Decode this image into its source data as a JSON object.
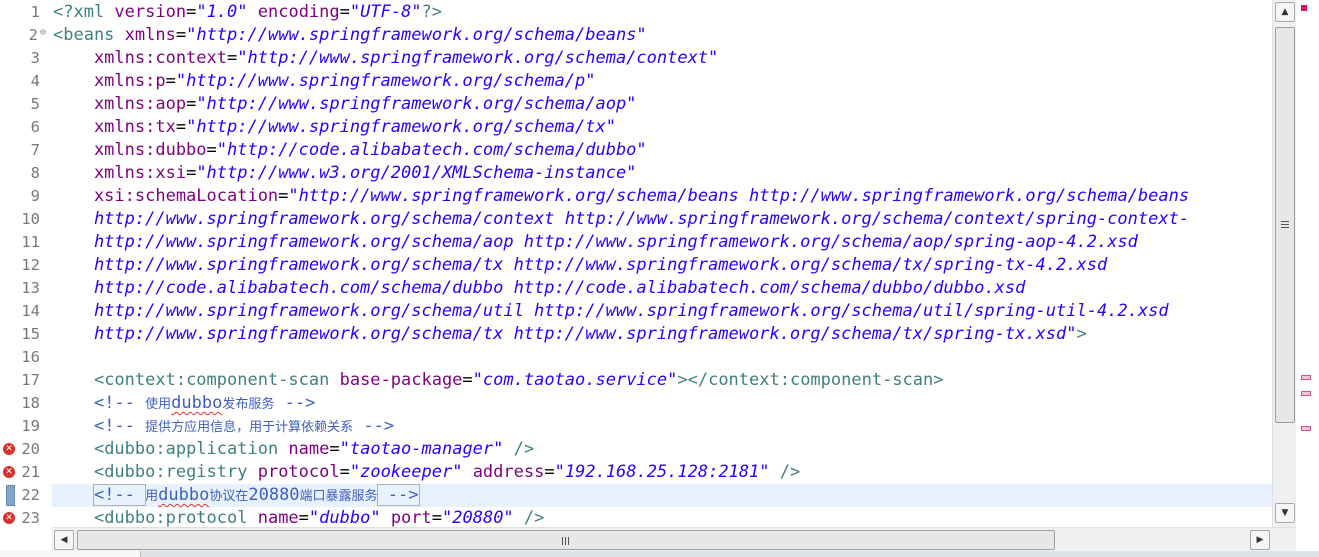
{
  "editor": {
    "line_numbers": [
      "1",
      "2",
      "3",
      "4",
      "5",
      "6",
      "7",
      "8",
      "9",
      "10",
      "11",
      "12",
      "13",
      "14",
      "15",
      "16",
      "17",
      "18",
      "19",
      "20",
      "21",
      "22",
      "23"
    ],
    "fold_icon": "collapse-icon",
    "lines": {
      "l1": {
        "decl_open": "<?xml ",
        "a1": "version",
        "eq1": "=",
        "v1": "\"1.0\"",
        "a2": " encoding",
        "eq2": "=",
        "v2": "\"UTF-8\"",
        "decl_close": "?>"
      },
      "l2": {
        "tag": "<beans ",
        "attr": "xmlns",
        "eq": "=",
        "val": "\"http://www.springframework.org/schema/beans\""
      },
      "l3": {
        "attr": "    xmlns:context",
        "eq": "=",
        "val": "\"http://www.springframework.org/schema/context\""
      },
      "l4": {
        "attr": "    xmlns:p",
        "eq": "=",
        "val": "\"http://www.springframework.org/schema/p\""
      },
      "l5": {
        "attr": "    xmlns:aop",
        "eq": "=",
        "val": "\"http://www.springframework.org/schema/aop\""
      },
      "l6": {
        "attr": "    xmlns:tx",
        "eq": "=",
        "val": "\"http://www.springframework.org/schema/tx\""
      },
      "l7": {
        "attr": "    xmlns:dubbo",
        "eq": "=",
        "val": "\"http://code.alibabatech.com/schema/dubbo\""
      },
      "l8": {
        "attr": "    xmlns:xsi",
        "eq": "=",
        "val": "\"http://www.w3.org/2001/XMLSchema-instance\""
      },
      "l9": {
        "attr": "    xsi:schemaLocation",
        "eq": "=",
        "val": "\"http://www.springframework.org/schema/beans http://www.springframework.org/schema/beans"
      },
      "l10": {
        "val": "    http://www.springframework.org/schema/context http://www.springframework.org/schema/context/spring-context-"
      },
      "l11": {
        "val": "    http://www.springframework.org/schema/aop http://www.springframework.org/schema/aop/spring-aop-4.2.xsd"
      },
      "l12": {
        "val": "    http://www.springframework.org/schema/tx http://www.springframework.org/schema/tx/spring-tx-4.2.xsd"
      },
      "l13": {
        "val": "    http://code.alibabatech.com/schema/dubbo http://code.alibabatech.com/schema/dubbo/dubbo.xsd"
      },
      "l14": {
        "val": "    http://www.springframework.org/schema/util http://www.springframework.org/schema/util/spring-util-4.2.xsd"
      },
      "l15": {
        "val": "    http://www.springframework.org/schema/tx http://www.springframework.org/schema/tx/spring-tx.xsd\"",
        "close": ">"
      },
      "l16": {},
      "l17": {
        "indent": "    ",
        "tag": "<context:component-scan ",
        "attr": "base-package",
        "eq": "=",
        "val": "\"com.taotao.service\"",
        "close": "></context:component-scan>"
      },
      "l18": {
        "indent": "    ",
        "open": "<!-- ",
        "cjk1": "使用",
        "word": "dubbo",
        "cjk2": "发布服务",
        "close": " -->"
      },
      "l19": {
        "indent": "    ",
        "open": "<!-- ",
        "cjk1": "提供方应用信息，用于计算依赖关系",
        "close": " -->"
      },
      "l20": {
        "indent": "    ",
        "tag": "<dubbo:application ",
        "attr": "name",
        "eq": "=",
        "val": "\"taotao-manager\"",
        "close": " />"
      },
      "l21": {
        "indent": "    ",
        "tag": "<dubbo:registry ",
        "a1": "protocol",
        "eq1": "=",
        "v1": "\"zookeeper\"",
        "a2": " address",
        "eq2": "=",
        "v2": "\"192.168.25.128:2181\"",
        "close": " />"
      },
      "l22": {
        "indent": "    ",
        "open": "<!-- ",
        "cjk1": "用",
        "word": "dubbo",
        "cjk2": "协议在",
        "num": "20880",
        "cjk3": "端口暴露服务",
        "close": " -->"
      },
      "l23": {
        "indent": "    ",
        "tag": "<dubbo:protocol ",
        "a1": "name",
        "eq1": "=",
        "v1": "\"dubbo\"",
        "a2": " port",
        "eq2": "=",
        "v2": "\"20880\"",
        "close": " />"
      }
    },
    "error_lines": [
      "20",
      "21",
      "23"
    ],
    "current_line": "22"
  },
  "scrollbars": {
    "up_arrow": "▲",
    "down_arrow": "▼",
    "left_arrow": "◀",
    "right_arrow": "▶"
  },
  "colors": {
    "tag": "#3f7f7f",
    "attribute": "#7f007f",
    "string": "#2a00ff",
    "comment": "#3f5fbf",
    "error": "#d9302c",
    "current_line": "#e8f2fe"
  }
}
